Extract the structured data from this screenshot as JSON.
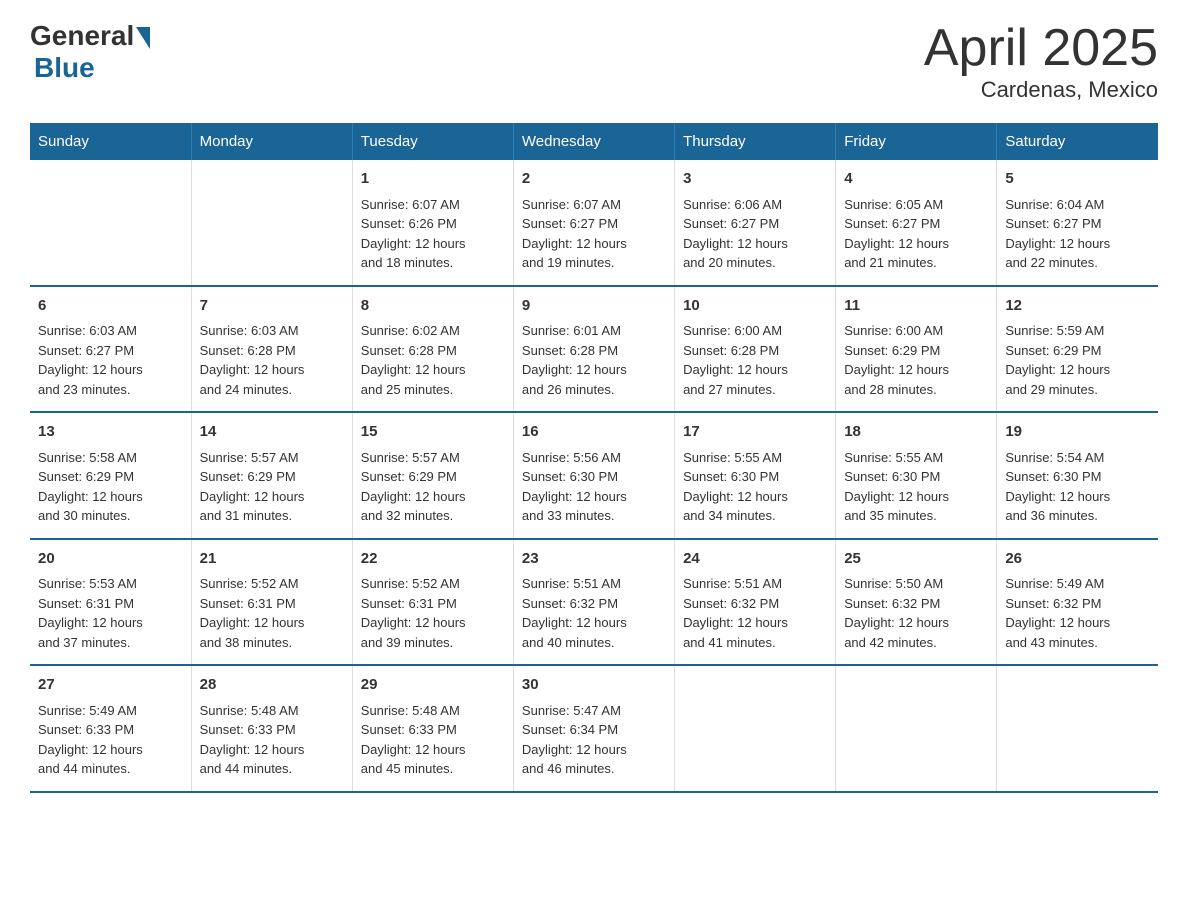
{
  "header": {
    "logo_general": "General",
    "logo_blue": "Blue",
    "title": "April 2025",
    "subtitle": "Cardenas, Mexico"
  },
  "days_of_week": [
    "Sunday",
    "Monday",
    "Tuesday",
    "Wednesday",
    "Thursday",
    "Friday",
    "Saturday"
  ],
  "weeks": [
    [
      {
        "day": "",
        "info": ""
      },
      {
        "day": "",
        "info": ""
      },
      {
        "day": "1",
        "info": "Sunrise: 6:07 AM\nSunset: 6:26 PM\nDaylight: 12 hours\nand 18 minutes."
      },
      {
        "day": "2",
        "info": "Sunrise: 6:07 AM\nSunset: 6:27 PM\nDaylight: 12 hours\nand 19 minutes."
      },
      {
        "day": "3",
        "info": "Sunrise: 6:06 AM\nSunset: 6:27 PM\nDaylight: 12 hours\nand 20 minutes."
      },
      {
        "day": "4",
        "info": "Sunrise: 6:05 AM\nSunset: 6:27 PM\nDaylight: 12 hours\nand 21 minutes."
      },
      {
        "day": "5",
        "info": "Sunrise: 6:04 AM\nSunset: 6:27 PM\nDaylight: 12 hours\nand 22 minutes."
      }
    ],
    [
      {
        "day": "6",
        "info": "Sunrise: 6:03 AM\nSunset: 6:27 PM\nDaylight: 12 hours\nand 23 minutes."
      },
      {
        "day": "7",
        "info": "Sunrise: 6:03 AM\nSunset: 6:28 PM\nDaylight: 12 hours\nand 24 minutes."
      },
      {
        "day": "8",
        "info": "Sunrise: 6:02 AM\nSunset: 6:28 PM\nDaylight: 12 hours\nand 25 minutes."
      },
      {
        "day": "9",
        "info": "Sunrise: 6:01 AM\nSunset: 6:28 PM\nDaylight: 12 hours\nand 26 minutes."
      },
      {
        "day": "10",
        "info": "Sunrise: 6:00 AM\nSunset: 6:28 PM\nDaylight: 12 hours\nand 27 minutes."
      },
      {
        "day": "11",
        "info": "Sunrise: 6:00 AM\nSunset: 6:29 PM\nDaylight: 12 hours\nand 28 minutes."
      },
      {
        "day": "12",
        "info": "Sunrise: 5:59 AM\nSunset: 6:29 PM\nDaylight: 12 hours\nand 29 minutes."
      }
    ],
    [
      {
        "day": "13",
        "info": "Sunrise: 5:58 AM\nSunset: 6:29 PM\nDaylight: 12 hours\nand 30 minutes."
      },
      {
        "day": "14",
        "info": "Sunrise: 5:57 AM\nSunset: 6:29 PM\nDaylight: 12 hours\nand 31 minutes."
      },
      {
        "day": "15",
        "info": "Sunrise: 5:57 AM\nSunset: 6:29 PM\nDaylight: 12 hours\nand 32 minutes."
      },
      {
        "day": "16",
        "info": "Sunrise: 5:56 AM\nSunset: 6:30 PM\nDaylight: 12 hours\nand 33 minutes."
      },
      {
        "day": "17",
        "info": "Sunrise: 5:55 AM\nSunset: 6:30 PM\nDaylight: 12 hours\nand 34 minutes."
      },
      {
        "day": "18",
        "info": "Sunrise: 5:55 AM\nSunset: 6:30 PM\nDaylight: 12 hours\nand 35 minutes."
      },
      {
        "day": "19",
        "info": "Sunrise: 5:54 AM\nSunset: 6:30 PM\nDaylight: 12 hours\nand 36 minutes."
      }
    ],
    [
      {
        "day": "20",
        "info": "Sunrise: 5:53 AM\nSunset: 6:31 PM\nDaylight: 12 hours\nand 37 minutes."
      },
      {
        "day": "21",
        "info": "Sunrise: 5:52 AM\nSunset: 6:31 PM\nDaylight: 12 hours\nand 38 minutes."
      },
      {
        "day": "22",
        "info": "Sunrise: 5:52 AM\nSunset: 6:31 PM\nDaylight: 12 hours\nand 39 minutes."
      },
      {
        "day": "23",
        "info": "Sunrise: 5:51 AM\nSunset: 6:32 PM\nDaylight: 12 hours\nand 40 minutes."
      },
      {
        "day": "24",
        "info": "Sunrise: 5:51 AM\nSunset: 6:32 PM\nDaylight: 12 hours\nand 41 minutes."
      },
      {
        "day": "25",
        "info": "Sunrise: 5:50 AM\nSunset: 6:32 PM\nDaylight: 12 hours\nand 42 minutes."
      },
      {
        "day": "26",
        "info": "Sunrise: 5:49 AM\nSunset: 6:32 PM\nDaylight: 12 hours\nand 43 minutes."
      }
    ],
    [
      {
        "day": "27",
        "info": "Sunrise: 5:49 AM\nSunset: 6:33 PM\nDaylight: 12 hours\nand 44 minutes."
      },
      {
        "day": "28",
        "info": "Sunrise: 5:48 AM\nSunset: 6:33 PM\nDaylight: 12 hours\nand 44 minutes."
      },
      {
        "day": "29",
        "info": "Sunrise: 5:48 AM\nSunset: 6:33 PM\nDaylight: 12 hours\nand 45 minutes."
      },
      {
        "day": "30",
        "info": "Sunrise: 5:47 AM\nSunset: 6:34 PM\nDaylight: 12 hours\nand 46 minutes."
      },
      {
        "day": "",
        "info": ""
      },
      {
        "day": "",
        "info": ""
      },
      {
        "day": "",
        "info": ""
      }
    ]
  ]
}
